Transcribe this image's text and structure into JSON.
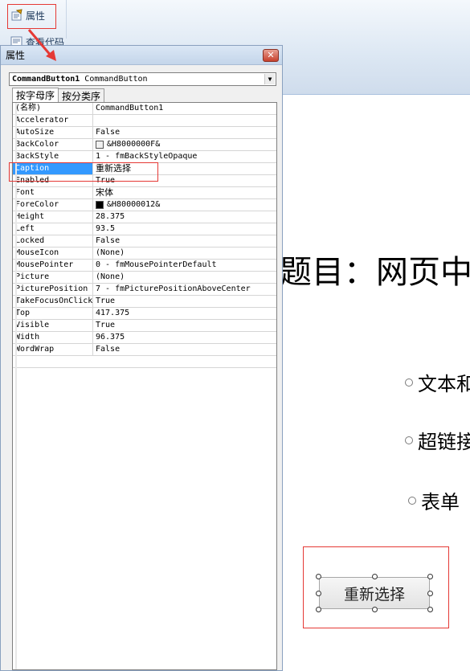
{
  "ribbon": {
    "properties_label": "属性",
    "view_code_label": "查看代码"
  },
  "window": {
    "title": "属性",
    "close_glyph": "✕"
  },
  "object_selector": {
    "name": "CommandButton1",
    "type": "CommandButton"
  },
  "tabs": [
    {
      "label": "按字母序",
      "active": true
    },
    {
      "label": "按分类序",
      "active": false
    }
  ],
  "properties": [
    {
      "name": "(名称)",
      "value": "CommandButton1"
    },
    {
      "name": "Accelerator",
      "value": ""
    },
    {
      "name": "AutoSize",
      "value": "False"
    },
    {
      "name": "BackColor",
      "value": "&H8000000F&",
      "swatch": "#f0f0f0"
    },
    {
      "name": "BackStyle",
      "value": "1 - fmBackStyleOpaque"
    },
    {
      "name": "Caption",
      "value": "重新选择",
      "selected": true
    },
    {
      "name": "Enabled",
      "value": "True"
    },
    {
      "name": "Font",
      "value": "宋体"
    },
    {
      "name": "ForeColor",
      "value": "&H80000012&",
      "swatch": "#000000"
    },
    {
      "name": "Height",
      "value": "28.375"
    },
    {
      "name": "Left",
      "value": "93.5"
    },
    {
      "name": "Locked",
      "value": "False"
    },
    {
      "name": "MouseIcon",
      "value": "(None)"
    },
    {
      "name": "MousePointer",
      "value": "0 - fmMousePointerDefault"
    },
    {
      "name": "Picture",
      "value": "(None)"
    },
    {
      "name": "PicturePosition",
      "value": "7 - fmPicturePositionAboveCenter"
    },
    {
      "name": "TakeFocusOnClick",
      "value": "True"
    },
    {
      "name": "Top",
      "value": "417.375"
    },
    {
      "name": "Visible",
      "value": "True"
    },
    {
      "name": "Width",
      "value": "96.375"
    },
    {
      "name": "WordWrap",
      "value": "False"
    }
  ],
  "document": {
    "title": "题目：网页中",
    "options": [
      "文本和",
      "超链接",
      "表单"
    ],
    "button_caption": "重新选择"
  },
  "colors": {
    "highlight": "#e53935",
    "selection": "#3399ff"
  }
}
